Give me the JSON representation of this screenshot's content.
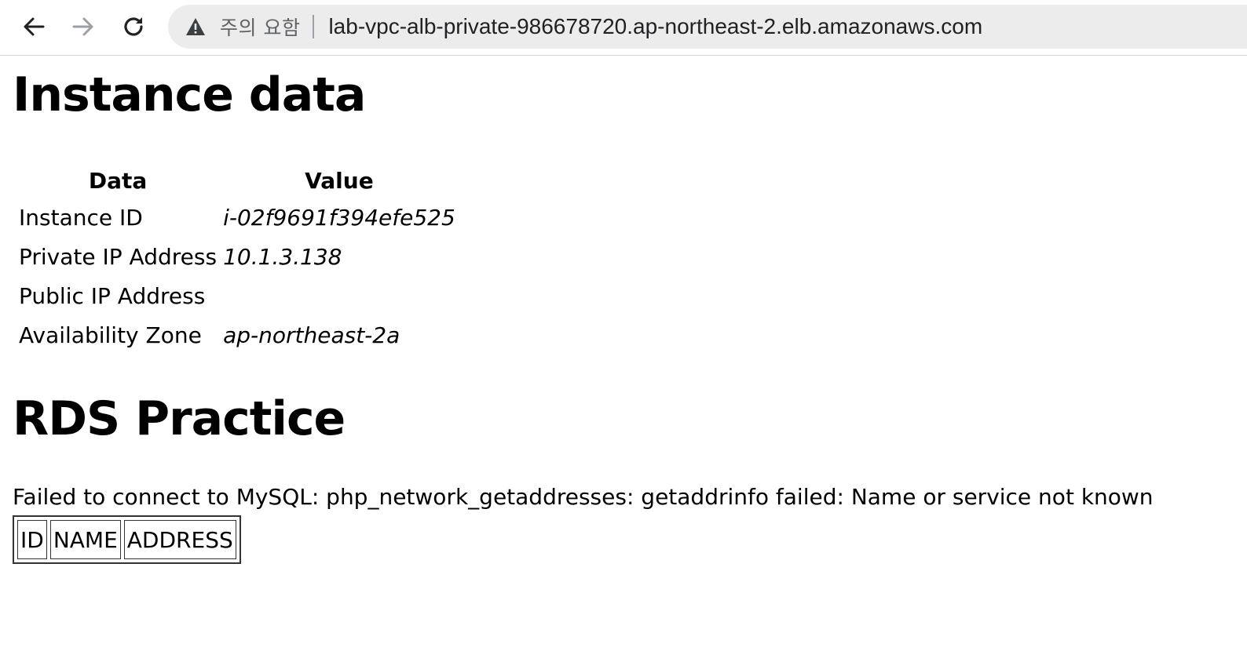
{
  "browser": {
    "back_icon": "arrow-left-icon",
    "forward_icon": "arrow-right-icon",
    "reload_icon": "reload-icon",
    "warning_icon": "warning-triangle-icon",
    "security_label": "주의 요함",
    "url": "lab-vpc-alb-private-986678720.ap-northeast-2.elb.amazonaws.com",
    "colors": {
      "omnibox_bg": "#ececec",
      "forward_disabled": "#9aa0a6"
    }
  },
  "instance": {
    "heading": "Instance data",
    "columns": [
      "Data",
      "Value"
    ],
    "rows": [
      {
        "label": "Instance ID",
        "value": "i-02f9691f394efe525"
      },
      {
        "label": "Private IP Address",
        "value": "10.1.3.138"
      },
      {
        "label": "Public IP Address",
        "value": ""
      },
      {
        "label": "Availability Zone",
        "value": "ap-northeast-2a"
      }
    ]
  },
  "rds": {
    "heading": "RDS Practice",
    "error": "Failed to connect to MySQL: php_network_getaddresses: getaddrinfo failed: Name or service not known",
    "columns": [
      "ID",
      "NAME",
      "ADDRESS"
    ]
  }
}
